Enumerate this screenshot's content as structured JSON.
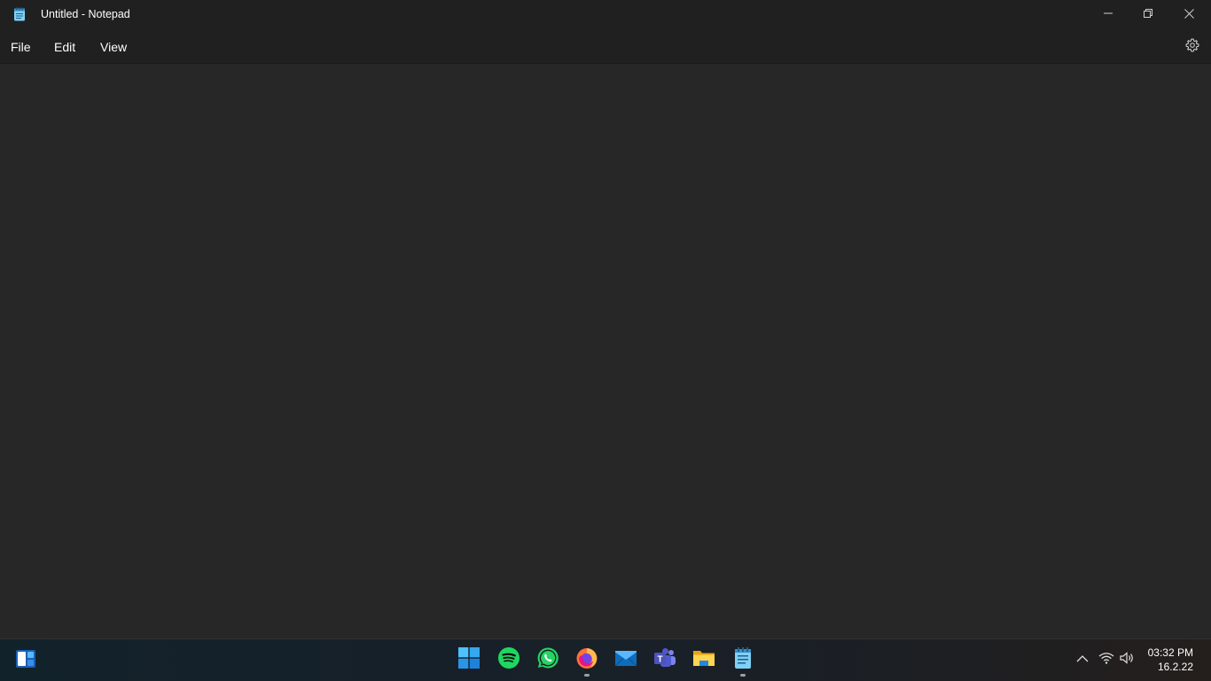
{
  "window": {
    "title": "Untitled - Notepad",
    "app_icon": "notepad-icon"
  },
  "title_controls": {
    "minimize_icon": "minimize-icon",
    "maximize_icon": "restore-icon",
    "close_icon": "close-icon"
  },
  "menu": {
    "file_label": "File",
    "edit_label": "Edit",
    "view_label": "View",
    "settings_icon": "gear-icon"
  },
  "editor": {
    "content": ""
  },
  "taskbar": {
    "widgets_icon": "widgets-icon",
    "apps": [
      {
        "name": "Start",
        "icon": "windows-start-icon",
        "color": "#3aa7f0"
      },
      {
        "name": "Spotify",
        "icon": "spotify-icon",
        "color": "#1ed760"
      },
      {
        "name": "WhatsApp",
        "icon": "whatsapp-icon",
        "color": "#25d366"
      },
      {
        "name": "Firefox",
        "icon": "firefox-icon",
        "color": "#ff7139",
        "running": true
      },
      {
        "name": "Mail",
        "icon": "mail-icon",
        "color": "#1d8bf1"
      },
      {
        "name": "Teams",
        "icon": "teams-icon",
        "color": "#6264a7"
      },
      {
        "name": "File Explorer",
        "icon": "folder-icon",
        "color": "#f8c840"
      },
      {
        "name": "Notepad",
        "icon": "notepad-icon",
        "color": "#6ec6f0",
        "running": true
      }
    ],
    "tray": {
      "overflow_icon": "chevron-up-icon",
      "wifi_icon": "wifi-icon",
      "volume_icon": "volume-icon"
    },
    "clock": {
      "time": "03:32 PM",
      "date": "16.2.22"
    }
  },
  "colors": {
    "titlebar_bg": "#202020",
    "editor_bg": "#272727",
    "text": "#ffffff"
  }
}
